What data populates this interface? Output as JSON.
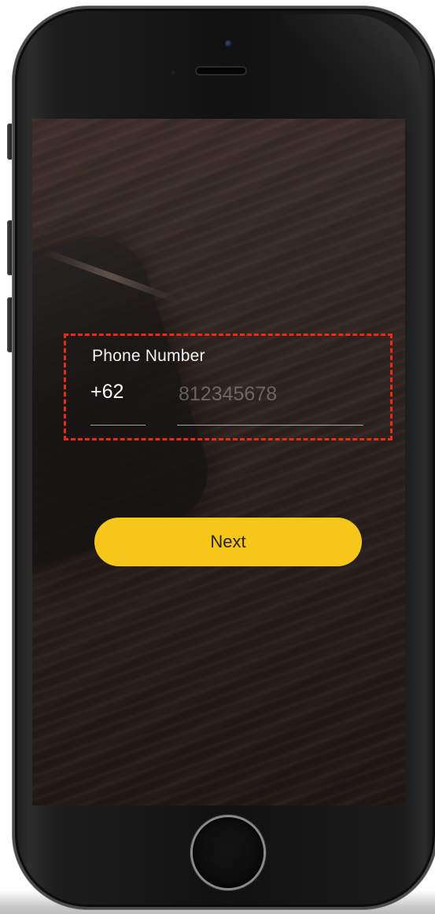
{
  "form": {
    "label": "Phone Number",
    "country_code": "+62",
    "phone_placeholder": "812345678",
    "phone_value": ""
  },
  "actions": {
    "next_label": "Next"
  },
  "colors": {
    "accent": "#f5c718",
    "highlight_box": "#ee2a14"
  },
  "icons": {
    "home": "home-button"
  }
}
